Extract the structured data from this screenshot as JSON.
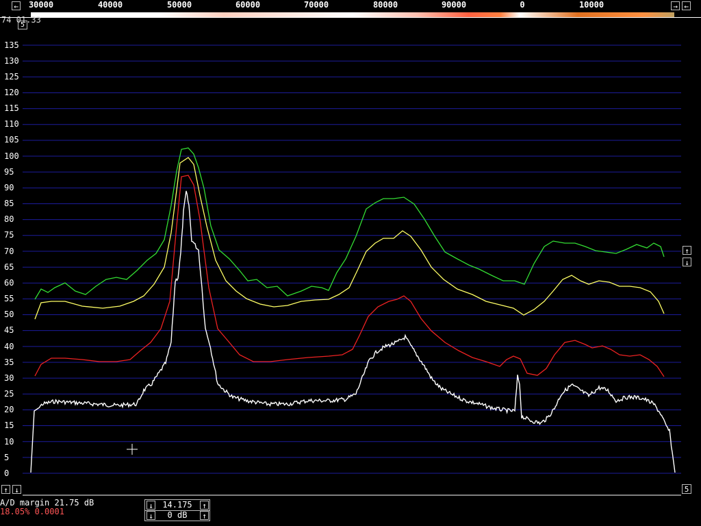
{
  "freq_scale": {
    "labels": [
      "30000",
      "40000",
      "50000",
      "60000",
      "70000",
      "80000",
      "90000",
      "0",
      "10000"
    ]
  },
  "top_left_text": "74 01.33",
  "top_left_box": "5",
  "y_axis": {
    "labels": [
      "135",
      "130",
      "125",
      "120",
      "115",
      "110",
      "105",
      "100",
      "95",
      "90",
      "85",
      "80",
      "75",
      "70",
      "65",
      "60",
      "55",
      "50",
      "45",
      "40",
      "35",
      "30",
      "25",
      "20",
      "15",
      "10",
      "5",
      "0"
    ]
  },
  "right_box": "5",
  "status": {
    "ad_margin": "A/D margin 21.75 dB",
    "stats": "18.05% 0.0001"
  },
  "controls": {
    "freq_value": "14.175",
    "gain_value": "0 dB"
  },
  "buttons": {
    "left": "←",
    "right": "→",
    "up": "↑",
    "down": "↓"
  },
  "colors": {
    "grid": "#1c1c9c",
    "green": "#33dd33",
    "yellow": "#ffff66",
    "red": "#ee2222",
    "white": "#ffffff",
    "stats_red": "#ff5555"
  }
}
